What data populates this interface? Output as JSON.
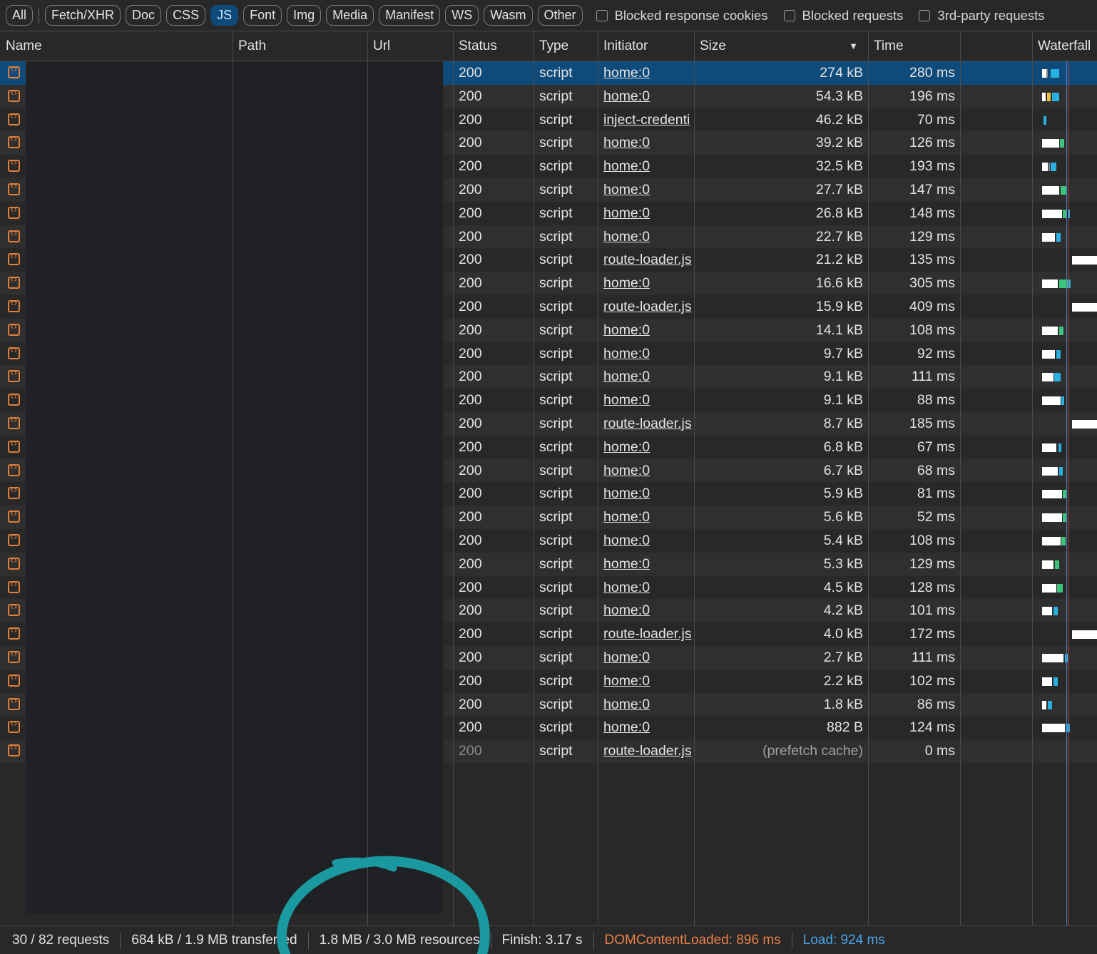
{
  "filters": {
    "chips": [
      "All",
      "Fetch/XHR",
      "Doc",
      "CSS",
      "JS",
      "Font",
      "Img",
      "Media",
      "Manifest",
      "WS",
      "Wasm",
      "Other"
    ],
    "active": "JS",
    "checkboxes": [
      "Blocked response cookies",
      "Blocked requests",
      "3rd-party requests"
    ]
  },
  "columns": {
    "name": "Name",
    "path": "Path",
    "url": "Url",
    "status": "Status",
    "type": "Type",
    "initiator": "Initiator",
    "size": "Size",
    "time": "Time",
    "waterfall": "Waterfall"
  },
  "rows": [
    {
      "status": "200",
      "type": "script",
      "initiator": "home:0",
      "size": "274 kB",
      "time": "280 ms"
    },
    {
      "status": "200",
      "type": "script",
      "initiator": "home:0",
      "size": "54.3 kB",
      "time": "196 ms"
    },
    {
      "status": "200",
      "type": "script",
      "initiator": "inject-credenti",
      "size": "46.2 kB",
      "time": "70 ms"
    },
    {
      "status": "200",
      "type": "script",
      "initiator": "home:0",
      "size": "39.2 kB",
      "time": "126 ms"
    },
    {
      "status": "200",
      "type": "script",
      "initiator": "home:0",
      "size": "32.5 kB",
      "time": "193 ms"
    },
    {
      "status": "200",
      "type": "script",
      "initiator": "home:0",
      "size": "27.7 kB",
      "time": "147 ms"
    },
    {
      "status": "200",
      "type": "script",
      "initiator": "home:0",
      "size": "26.8 kB",
      "time": "148 ms"
    },
    {
      "status": "200",
      "type": "script",
      "initiator": "home:0",
      "size": "22.7 kB",
      "time": "129 ms"
    },
    {
      "status": "200",
      "type": "script",
      "initiator": "route-loader.js",
      "size": "21.2 kB",
      "time": "135 ms"
    },
    {
      "status": "200",
      "type": "script",
      "initiator": "home:0",
      "size": "16.6 kB",
      "time": "305 ms"
    },
    {
      "status": "200",
      "type": "script",
      "initiator": "route-loader.js",
      "size": "15.9 kB",
      "time": "409 ms"
    },
    {
      "status": "200",
      "type": "script",
      "initiator": "home:0",
      "size": "14.1 kB",
      "time": "108 ms"
    },
    {
      "status": "200",
      "type": "script",
      "initiator": "home:0",
      "size": "9.7 kB",
      "time": "92 ms"
    },
    {
      "status": "200",
      "type": "script",
      "initiator": "home:0",
      "size": "9.1 kB",
      "time": "111 ms"
    },
    {
      "status": "200",
      "type": "script",
      "initiator": "home:0",
      "size": "9.1 kB",
      "time": "88 ms"
    },
    {
      "status": "200",
      "type": "script",
      "initiator": "route-loader.js",
      "size": "8.7 kB",
      "time": "185 ms"
    },
    {
      "status": "200",
      "type": "script",
      "initiator": "home:0",
      "size": "6.8 kB",
      "time": "67 ms"
    },
    {
      "status": "200",
      "type": "script",
      "initiator": "home:0",
      "size": "6.7 kB",
      "time": "68 ms"
    },
    {
      "status": "200",
      "type": "script",
      "initiator": "home:0",
      "size": "5.9 kB",
      "time": "81 ms"
    },
    {
      "status": "200",
      "type": "script",
      "initiator": "home:0",
      "size": "5.6 kB",
      "time": "52 ms"
    },
    {
      "status": "200",
      "type": "script",
      "initiator": "home:0",
      "size": "5.4 kB",
      "time": "108 ms"
    },
    {
      "status": "200",
      "type": "script",
      "initiator": "home:0",
      "size": "5.3 kB",
      "time": "129 ms"
    },
    {
      "status": "200",
      "type": "script",
      "initiator": "home:0",
      "size": "4.5 kB",
      "time": "128 ms"
    },
    {
      "status": "200",
      "type": "script",
      "initiator": "home:0",
      "size": "4.2 kB",
      "time": "101 ms"
    },
    {
      "status": "200",
      "type": "script",
      "initiator": "route-loader.js",
      "size": "4.0 kB",
      "time": "172 ms"
    },
    {
      "status": "200",
      "type": "script",
      "initiator": "home:0",
      "size": "2.7 kB",
      "time": "111 ms"
    },
    {
      "status": "200",
      "type": "script",
      "initiator": "home:0",
      "size": "2.2 kB",
      "time": "102 ms"
    },
    {
      "status": "200",
      "type": "script",
      "initiator": "home:0",
      "size": "1.8 kB",
      "time": "86 ms"
    },
    {
      "status": "200",
      "type": "script",
      "initiator": "home:0",
      "size": "882 B",
      "time": "124 ms"
    },
    {
      "status": "200",
      "type": "script",
      "initiator": "route-loader.js",
      "size": "(prefetch cache)",
      "time": "0 ms"
    }
  ],
  "footer": {
    "requests": "30 / 82 requests",
    "transferred": "684 kB / 1.9 MB transferred",
    "resources": "1.8 MB / 3.0 MB resources",
    "finish": "Finish: 3.17 s",
    "dom": "DOMContentLoaded: 896 ms",
    "load": "Load: 924 ms"
  },
  "colors": {
    "accent": "#0e4a7a",
    "icon": "#e0803a",
    "dom": "#e8804a",
    "load": "#4aa3e8",
    "annotation": "#1a9aa0"
  },
  "icons": {
    "row": "js-file-icon",
    "sort": "sort-desc-icon"
  }
}
